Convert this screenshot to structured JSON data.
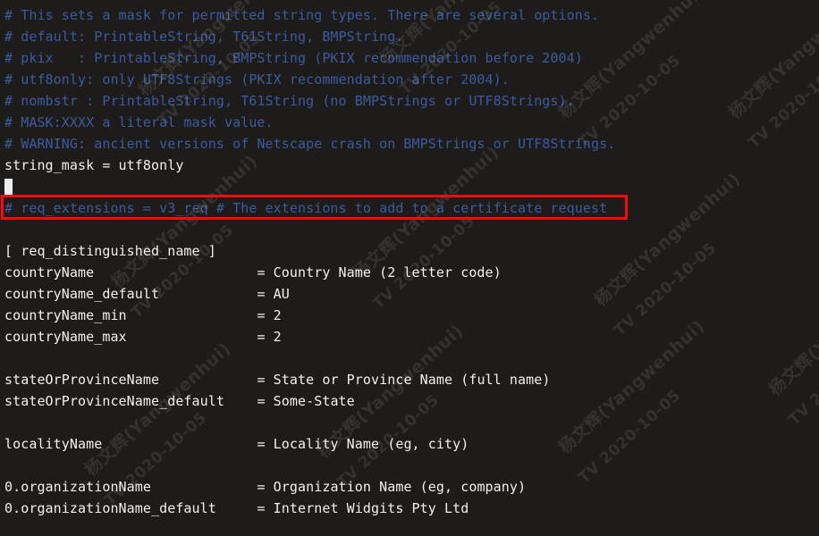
{
  "terminal": {
    "background_color": "#1e1c1b",
    "comment_color": "#3c5a9e",
    "text_color": "#f2f0ee",
    "cursor_color": "#efefef",
    "annotation_color": "#fb0b08",
    "lines": [
      {
        "type": "comment",
        "text": "# This sets a mask for permitted string types. There are several options."
      },
      {
        "type": "comment",
        "text": "# default: PrintableString, T61String, BMPString."
      },
      {
        "type": "comment",
        "text": "# pkix   : PrintableString, BMPString (PKIX recommendation before 2004)"
      },
      {
        "type": "comment",
        "text": "# utf8only: only UTF8Strings (PKIX recommendation after 2004)."
      },
      {
        "type": "comment",
        "text": "# nombstr : PrintableString, T61String (no BMPStrings or UTF8Strings)."
      },
      {
        "type": "comment",
        "text": "# MASK:XXXX a literal mask value."
      },
      {
        "type": "comment",
        "text": "# WARNING: ancient versions of Netscape crash on BMPStrings or UTF8Strings."
      },
      {
        "type": "plain",
        "text": "string_mask = utf8only"
      },
      {
        "type": "blank",
        "text": ""
      },
      {
        "type": "comment",
        "text": "# req_extensions = v3_req # The extensions to add to a certificate request"
      },
      {
        "type": "blank",
        "text": ""
      },
      {
        "type": "section",
        "text": "[ req_distinguished_name ]"
      },
      {
        "type": "kv",
        "key": "countryName",
        "value": "= Country Name (2 letter code)"
      },
      {
        "type": "kv",
        "key": "countryName_default",
        "value": "= AU"
      },
      {
        "type": "kv",
        "key": "countryName_min",
        "value": "= 2"
      },
      {
        "type": "kv",
        "key": "countryName_max",
        "value": "= 2"
      },
      {
        "type": "blank",
        "text": ""
      },
      {
        "type": "kv",
        "key": "stateOrProvinceName",
        "value": "= State or Province Name (full name)"
      },
      {
        "type": "kv",
        "key": "stateOrProvinceName_default",
        "value": "= Some-State"
      },
      {
        "type": "blank",
        "text": ""
      },
      {
        "type": "kv",
        "key": "localityName",
        "value": "= Locality Name (eg, city)"
      },
      {
        "type": "blank",
        "text": ""
      },
      {
        "type": "kv",
        "key": "0.organizationName",
        "value": "= Organization Name (eg, company)"
      },
      {
        "type": "kv",
        "key": "0.organizationName_default",
        "value": "= Internet Widgits Pty Ltd"
      }
    ],
    "cursor": {
      "line_index": 8,
      "column": 0
    },
    "annotation": {
      "label": "req-extensions-highlight",
      "target_line_index": 9,
      "target_text": "# req_extensions = v3_req # The extensions to add to a certificate request"
    }
  },
  "watermark": {
    "name_line": "杨文辉(Yangwenhui)",
    "date_line": "TV 2020-10-05"
  }
}
